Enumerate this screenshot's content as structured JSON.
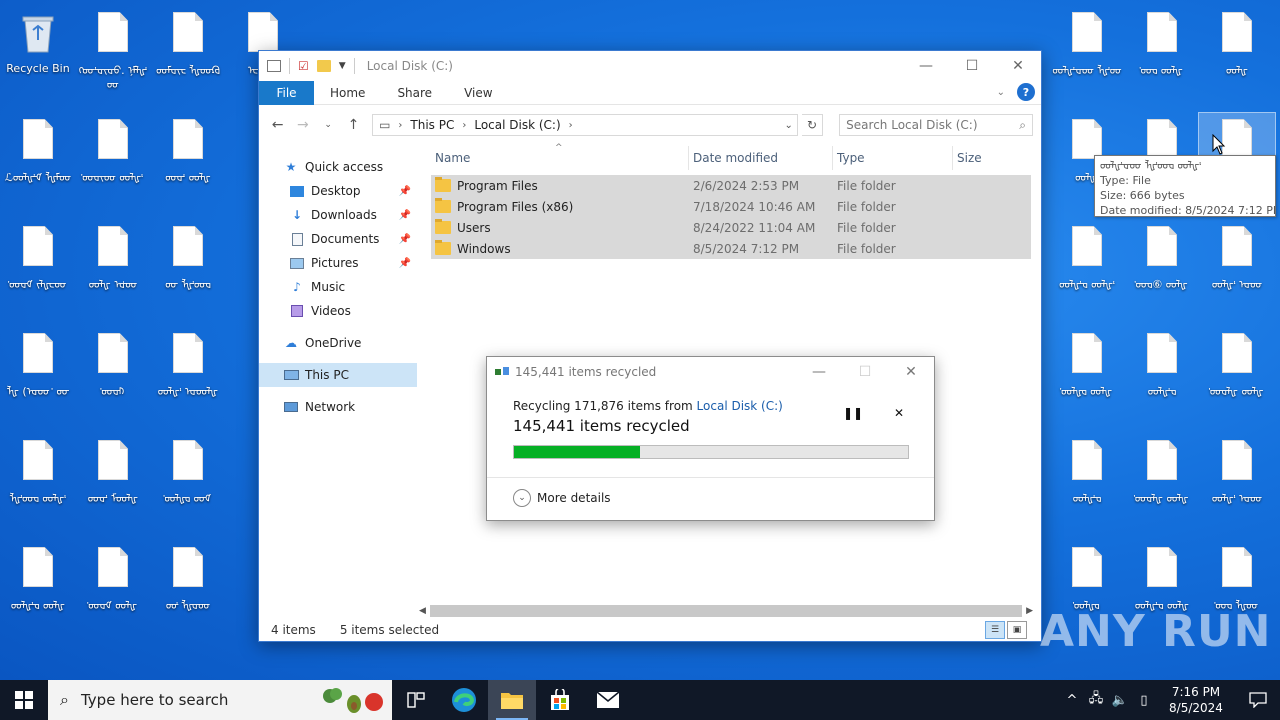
{
  "desktop": {
    "recycle_bin_label": "Recycle Bin",
    "icons": [
      {
        "label": "ᠬᡂᡃᡆᡕᡆᡉ. ᠨᡏᡀᡃᡂ",
        "col": 0,
        "row": 0
      },
      {
        "label": "ᡂᡏᡆᡕᡄ ᡀᡂᡗᡆ",
        "col": 1,
        "row": 0
      },
      {
        "label": "ᡄᡂᡏᡆ",
        "col": 2,
        "row": 0
      },
      {
        "label": "ℒᡂᡀᡃᡏ ᡀᡏᡂ",
        "col": 0,
        "row": 1
      },
      {
        "label": "ᡃᡂᡆᡕᡂ ᡂᡀᡃ",
        "col": 1,
        "row": 1
      },
      {
        "label": "ᡂᡆᡃ ᡂᡀ",
        "col": 2,
        "row": 1
      },
      {
        "label": "ᡃᡂᡆᡏ ᡕᡀᡄᡂ",
        "col": 0,
        "row": 2
      },
      {
        "label": "ᡂᡀ ᡆᡃᡂ",
        "col": 1,
        "row": 2
      },
      {
        "label": "ᡂ ᡀᡃᡂᡆ",
        "col": 2,
        "row": 2
      },
      {
        "label": "ᡀ (ᡆᡂ ᡃ ᡂ",
        "col": 0,
        "row": 3
      },
      {
        "label": "ᡃᡂᡆᡕ",
        "col": 1,
        "row": 3
      },
      {
        "label": "ᡂᡀᡃ ᡆᡂᡀ",
        "col": 2,
        "row": 3
      },
      {
        "label": "ᡀᡃᡂᡆ ᡂᡀᡃ",
        "col": 0,
        "row": 4
      },
      {
        "label": "ᡂᡆᡃ ᡏᡂᡀ",
        "col": 1,
        "row": 4
      },
      {
        "label": "ᡃᡂᡀᡆ ᡂᡏ",
        "col": 2,
        "row": 4
      },
      {
        "label": "ᡂᡀᡃᡆ ᡂᡀ",
        "col": 0,
        "row": 5
      },
      {
        "label": "ᡃᡂᡆᡏ ᡂᡀ",
        "col": 1,
        "row": 5
      },
      {
        "label": "ᡂᡃ ᡀᡆᡂ",
        "col": 2,
        "row": 5
      }
    ],
    "right_icons": [
      {
        "label": "ᡂᡀᡃᡆᡂ ᡀᡃᡂ",
        "col": 0,
        "row": 0
      },
      {
        "label": "ᡃᡂᡆ ᡂᡀ",
        "col": 1,
        "row": 0
      },
      {
        "label": "ᡂᡀ",
        "col": 2,
        "row": 0
      },
      {
        "label": "ᡂᡀᡃ",
        "col": 0,
        "row": 1
      },
      {
        "label": "",
        "col": 1,
        "row": 1
      },
      {
        "label": "",
        "col": 2,
        "row": 1
      },
      {
        "label": "ᡂᡀᡃᡆ ᡂᡀᡃ",
        "col": 0,
        "row": 2
      },
      {
        "label": "ᡃᡂᡆ⑥ ᡂᡀ",
        "col": 1,
        "row": 2
      },
      {
        "label": "ᡂᡀᡃ ᡆᡂ",
        "col": 2,
        "row": 2
      },
      {
        "label": "ᡃᡂᡀᡆ ᡂᡀ",
        "col": 0,
        "row": 3
      },
      {
        "label": "ᡂᡀᡃᡆ",
        "col": 1,
        "row": 3
      },
      {
        "label": "ᡃᡂᡆᡀ ᡂᡀ",
        "col": 2,
        "row": 3
      },
      {
        "label": "ᡂᡀᡃᡆ",
        "col": 0,
        "row": 4
      },
      {
        "label": "ᡃᡂᡆᡀ ᡂᡀ",
        "col": 1,
        "row": 4
      },
      {
        "label": "ᡂᡀᡃ ᡆᡂ",
        "col": 2,
        "row": 4
      },
      {
        "label": "ᡃᡂᡀᡆ",
        "col": 0,
        "row": 5
      },
      {
        "label": "ᡂᡀᡃᡆ ᡂᡀ",
        "col": 1,
        "row": 5
      },
      {
        "label": "ᡃᡂᡆ ᡀᡂ",
        "col": 2,
        "row": 5
      }
    ]
  },
  "explorer": {
    "title": "Local Disk (C:)",
    "ribbon": {
      "file": "File",
      "home": "Home",
      "share": "Share",
      "view": "View"
    },
    "breadcrumb": {
      "this_pc": "This PC",
      "local_disk": "Local Disk (C:)"
    },
    "search_placeholder": "Search Local Disk (C:)",
    "nav": {
      "quick_access": "Quick access",
      "desktop": "Desktop",
      "downloads": "Downloads",
      "documents": "Documents",
      "pictures": "Pictures",
      "music": "Music",
      "videos": "Videos",
      "onedrive": "OneDrive",
      "this_pc": "This PC",
      "network": "Network"
    },
    "columns": {
      "name": "Name",
      "date": "Date modified",
      "type": "Type",
      "size": "Size"
    },
    "rows": [
      {
        "name": "Program Files",
        "date": "2/6/2024 2:53 PM",
        "type": "File folder"
      },
      {
        "name": "Program Files (x86)",
        "date": "7/18/2024 10:46 AM",
        "type": "File folder"
      },
      {
        "name": "Users",
        "date": "8/24/2022 11:04 AM",
        "type": "File folder"
      },
      {
        "name": "Windows",
        "date": "8/5/2024 7:12 PM",
        "type": "File folder"
      }
    ],
    "status": {
      "items": "4 items",
      "selected": "5 items selected"
    }
  },
  "tooltip": {
    "name": "ᡂᡀᡃᡆᡂ ᡀᡃᡂᡆ ᡂᡀᡃ",
    "type": "Type: File",
    "size": "Size: 666 bytes",
    "date": "Date modified: 8/5/2024 7:12 PM"
  },
  "dialog": {
    "title": "145,441 items recycled",
    "line1_prefix": "Recycling 171,876 items from ",
    "line1_link": "Local Disk (C:)",
    "line2": "145,441 items recycled",
    "progress_percent": 32,
    "more_details": "More details"
  },
  "watermark": "ANY RUN",
  "taskbar": {
    "search_placeholder": "Type here to search",
    "time": "7:16 PM",
    "date": "8/5/2024"
  },
  "colors": {
    "accent": "#1979ca",
    "progress": "#06b025",
    "taskbar": "#101827"
  }
}
